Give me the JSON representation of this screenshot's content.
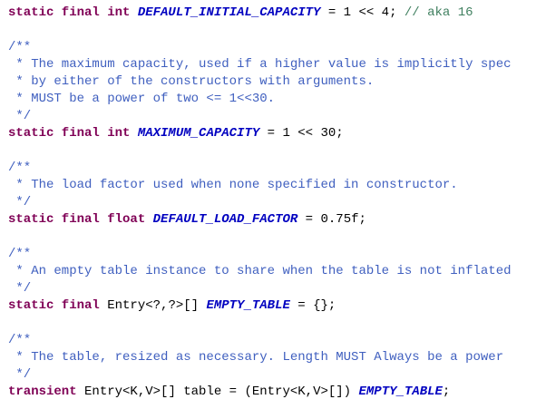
{
  "code": {
    "partial_top": " */",
    "l1": {
      "kw": "static final int",
      "name": "DEFAULT_INITIAL_CAPACITY",
      "rest": " = 1 << 4; ",
      "comment": "// aka 16"
    },
    "c2_open": "/**",
    "c2_l1": " * The maximum capacity, used if a higher value is implicitly spec",
    "c2_l2": " * by either of the constructors with arguments.",
    "c2_l3": " * MUST be a power of two <= 1<<30.",
    "c2_close": " */",
    "l2": {
      "kw": "static final int",
      "name": "MAXIMUM_CAPACITY",
      "rest": " = 1 << 30;"
    },
    "c3_open": "/**",
    "c3_l1": " * The load factor used when none specified in constructor.",
    "c3_close": " */",
    "l3": {
      "kw": "static final float",
      "name": "DEFAULT_LOAD_FACTOR",
      "rest": " = 0.75f;"
    },
    "c4_open": "/**",
    "c4_l1": " * An empty table instance to share when the table is not inflated",
    "c4_close": " */",
    "l4": {
      "kw": "static final",
      "type": " Entry<?,?>[] ",
      "name": "EMPTY_TABLE",
      "rest": " = {};"
    },
    "c5_open": "/**",
    "c5_l1": " * The table, resized as necessary. Length MUST Always be a power",
    "c5_close": " */",
    "l5": {
      "kw": "transient",
      "mid": " Entry<K,V>[] table = (Entry<K,V>[]) ",
      "name": "EMPTY_TABLE",
      "end": ";"
    }
  }
}
